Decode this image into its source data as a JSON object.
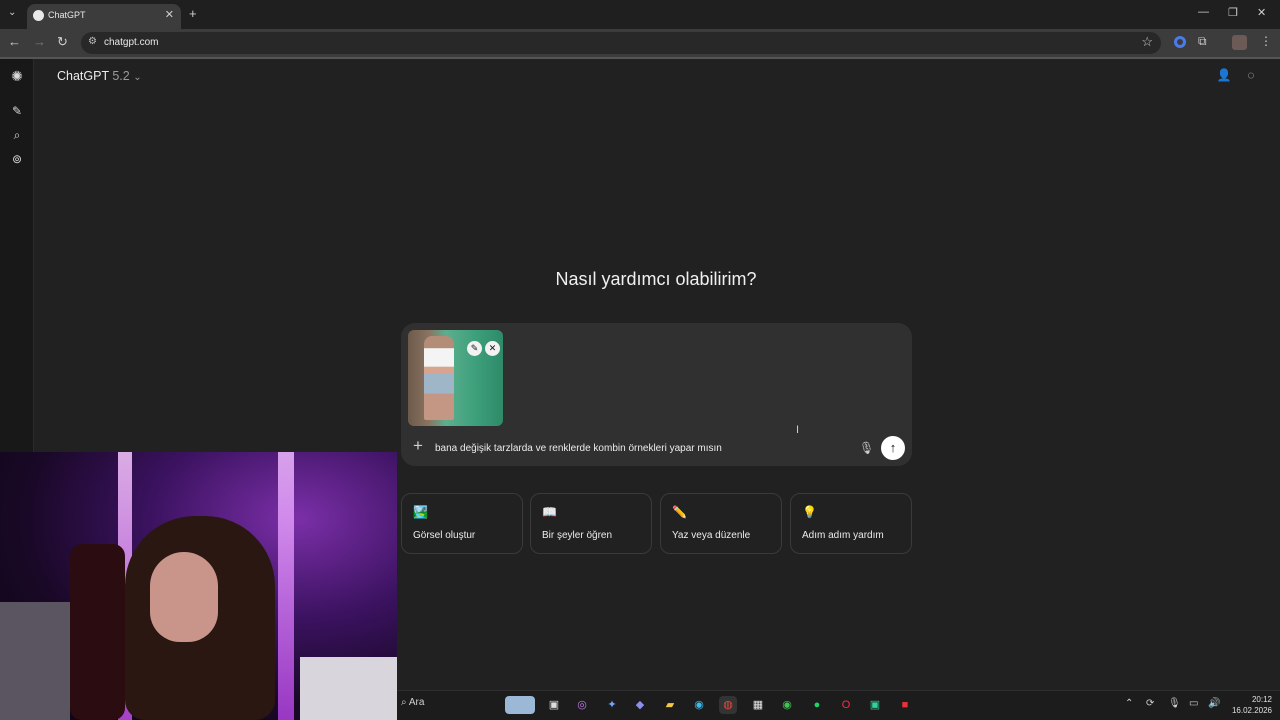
{
  "browser": {
    "tab_title": "ChatGPT",
    "url": "chatgpt.com"
  },
  "header": {
    "model_name": "ChatGPT",
    "model_version": "5.2"
  },
  "main": {
    "greeting": "Nasıl yardımcı olabilirim?",
    "prompt_text": "bana değişik tarzlarda ve renklerde kombin örnekleri yapar mısın"
  },
  "suggestions": [
    {
      "icon": "🏞️",
      "label": "Görsel oluştur"
    },
    {
      "icon": "📖",
      "label": "Bir şeyler öğren"
    },
    {
      "icon": "✏️",
      "label": "Yaz veya düzenle"
    },
    {
      "icon": "💡",
      "label": "Adım adım yardım"
    }
  ],
  "taskbar": {
    "search_label": "Ara",
    "time": "20:12",
    "date": "16.02.2026"
  },
  "colors": {
    "background": "#212121",
    "composer": "#303030",
    "accent_purple": "#8e3ad1"
  }
}
